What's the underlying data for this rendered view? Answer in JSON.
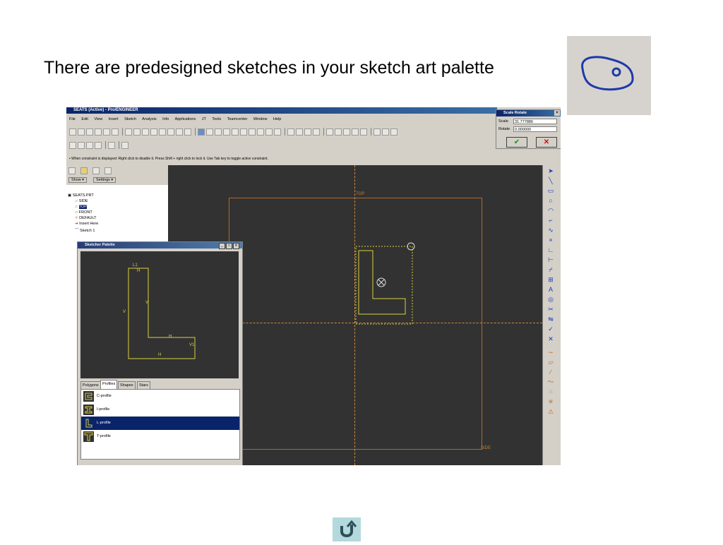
{
  "slide": {
    "title": "There are predesigned sketches in your sketch art palette"
  },
  "app": {
    "window_title": "SEATS (Active) - Pro/ENGINEER",
    "menu": [
      "File",
      "Edit",
      "View",
      "Insert",
      "Sketch",
      "Analysis",
      "Info",
      "Applications",
      "JT",
      "Tools",
      "Teamcenter",
      "Window",
      "Help"
    ],
    "status_message": "• When constraint is displayed: Right click to disable it. Press Shift + right click to lock it. Use Tab key to toggle active constraint.",
    "show_label": "Show ▾",
    "settings_label": "Settings ▾",
    "tree": [
      "SEATS.PRT",
      "SIDE",
      "TOP",
      "FRONT",
      "DEFAULT",
      "Insert Here",
      "Sketch 1"
    ],
    "canvas_labels": {
      "top": "TOP",
      "side": "SIDE"
    }
  },
  "scale_rotate": {
    "title": "Scale Rotate",
    "scale_label": "Scale",
    "scale_value": "31.777886",
    "rotate_label": "Rotate",
    "rotate_value": "0.000000"
  },
  "palette": {
    "title": "Sketcher Palette",
    "tabs": [
      "Polygons",
      "Profiles",
      "Shapes",
      "Stars"
    ],
    "active_tab": "Profiles",
    "items": [
      "C-profile",
      "I-profile",
      "L-profile",
      "T-profile"
    ],
    "selected": "L-profile",
    "preview_labels": {
      "l1": "L1",
      "h": "H",
      "v": "V",
      "v1": "V1"
    }
  },
  "colors": {
    "accent": "#0a246a",
    "canvas": "#323232",
    "sketch_line": "#c8c040",
    "datum": "#c08040"
  },
  "icons": [
    "sketcher-palette-icon",
    "home-return-icon"
  ]
}
